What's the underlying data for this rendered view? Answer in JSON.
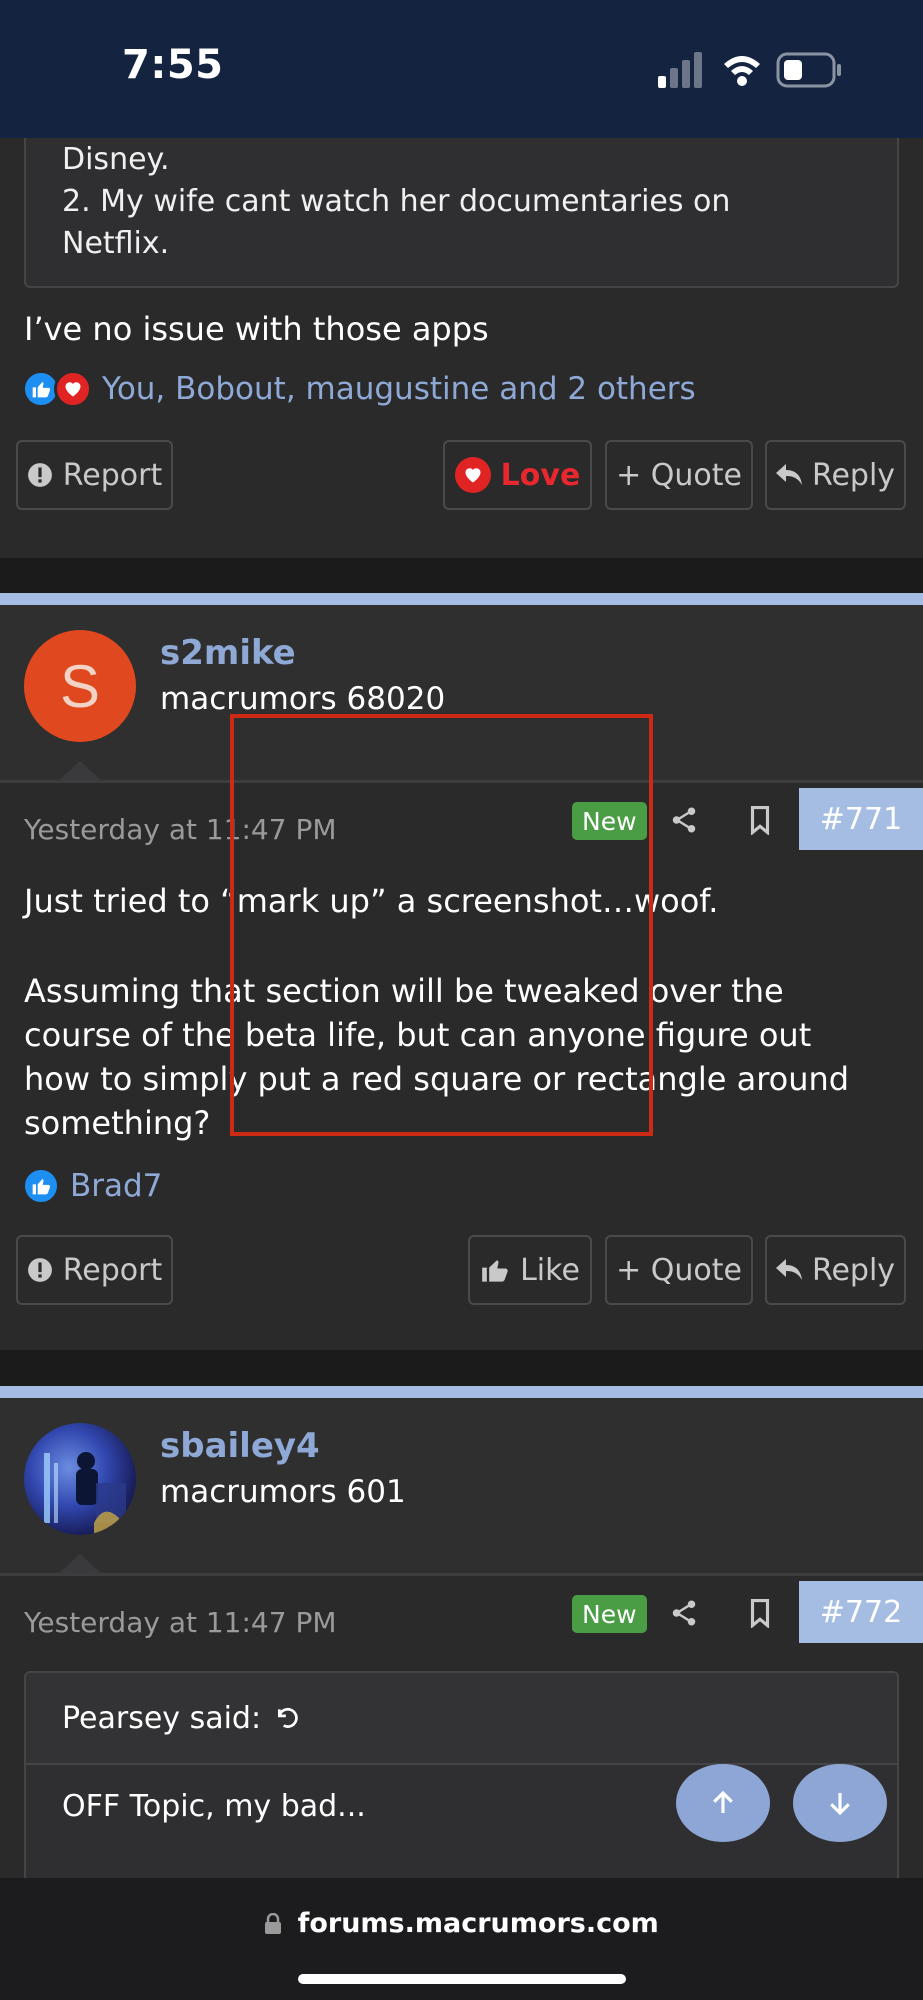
{
  "status_bar": {
    "time": "7:55"
  },
  "post_770": {
    "quote_lines": [
      "Disney.",
      "2. My wife cant watch her documentaries on",
      "Netflix."
    ],
    "body": "I’ve no issue with those apps",
    "reactions_text": "You, Bobout, maugustine and 2 others",
    "buttons": {
      "report": "Report",
      "love": "Love",
      "quote": "+ Quote",
      "reply": "Reply"
    }
  },
  "post_771": {
    "username": "s2mike",
    "user_title": "macrumors 68020",
    "avatar_letter": "S",
    "timestamp": "Yesterday at 11:47 PM",
    "badge": "New",
    "post_number": "#771",
    "body_line1": "Just tried to “mark up” a screenshot…woof.",
    "body_para2": [
      "Assuming that section will be tweaked over the",
      "course of the beta life, but can anyone figure out",
      "how to simply put a red square or rectangle around",
      "something?"
    ],
    "reactions_text": "Brad7",
    "buttons": {
      "report": "Report",
      "like": "Like",
      "quote": "+ Quote",
      "reply": "Reply"
    }
  },
  "post_772": {
    "username": "sbailey4",
    "user_title": "macrumors 601",
    "timestamp": "Yesterday at 11:47 PM",
    "badge": "New",
    "post_number": "#772",
    "quote_author": "Pearsey said:",
    "quote_text": "OFF Topic, my bad..."
  },
  "browser": {
    "url": "forums.macrumors.com"
  },
  "colors": {
    "accent": "#a6bde3",
    "username": "#8fa9d6",
    "new_badge": "#4a9d45",
    "love": "#e8282e",
    "markup": "#cc2a14"
  }
}
